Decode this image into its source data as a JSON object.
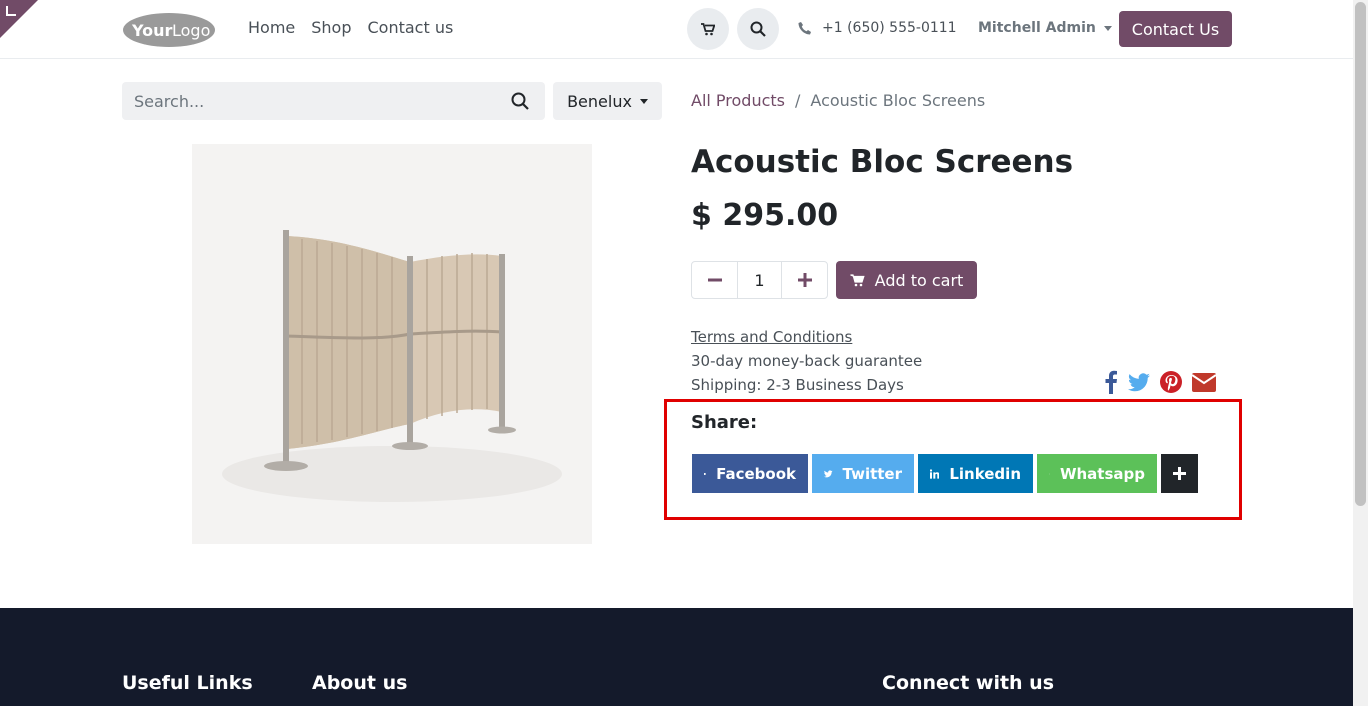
{
  "header": {
    "logo_text": "YourLogo",
    "nav": [
      "Home",
      "Shop",
      "Contact us"
    ],
    "phone": "+1 (650) 555-0111",
    "user": "Mitchell Admin",
    "contact_button": "Contact Us"
  },
  "search": {
    "placeholder": "Search...",
    "pricelist": "Benelux"
  },
  "breadcrumb": {
    "parent": "All Products",
    "separator": "/",
    "current": "Acoustic Bloc Screens"
  },
  "product": {
    "title": "Acoustic Bloc Screens",
    "price": "$ 295.00",
    "quantity": "1",
    "add_to_cart": "Add to cart",
    "terms": "Terms and Conditions",
    "guarantee": "30-day money-back guarantee",
    "shipping": "Shipping: 2-3 Business Days"
  },
  "share": {
    "label": "Share:",
    "buttons": [
      {
        "label": "Facebook",
        "color": "#3b5998"
      },
      {
        "label": "Twitter",
        "color": "#55acee"
      },
      {
        "label": "Linkedin",
        "color": "#0077b5"
      },
      {
        "label": "Whatsapp",
        "color": "#25d366"
      }
    ]
  },
  "footer": {
    "useful_links": "Useful Links",
    "about": "About us",
    "connect": "Connect with us"
  },
  "colors": {
    "brand": "#714b67",
    "highlight": "#e00000",
    "footer_bg": "#141a2b"
  }
}
